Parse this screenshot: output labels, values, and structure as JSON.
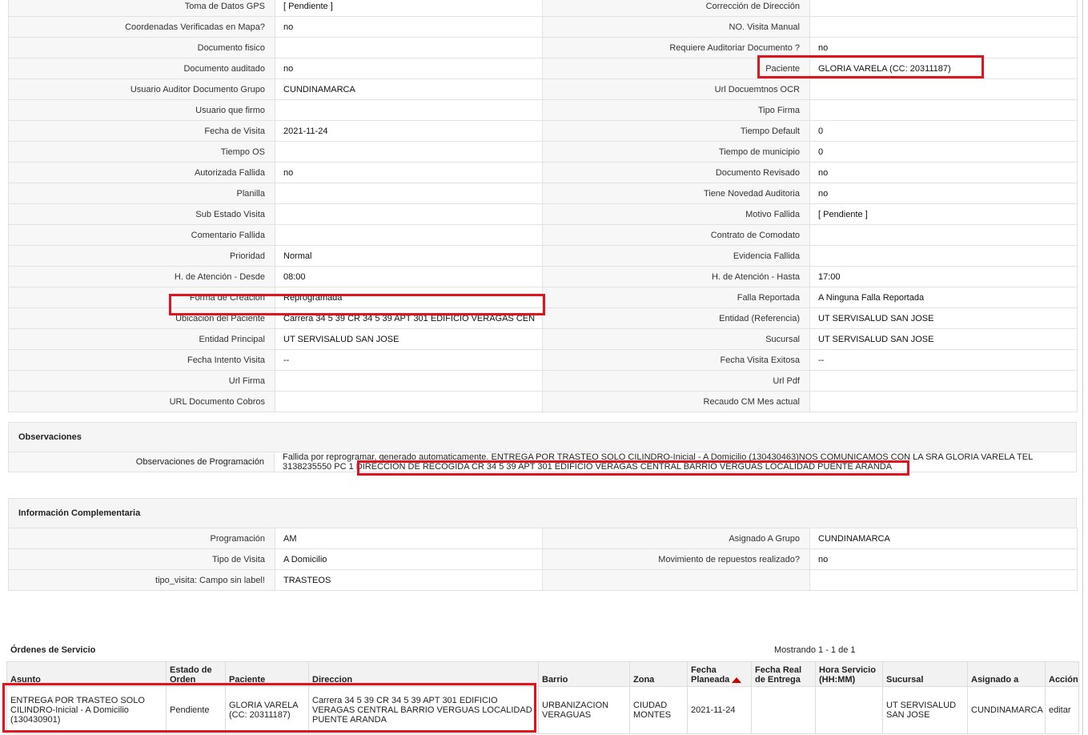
{
  "details": [
    {
      "l1": "Toma de Datos GPS",
      "v1": "[ Pendiente ]",
      "l2": "Corrección de Dirección",
      "v2": ""
    },
    {
      "l1": "Coordenadas Verificadas en Mapa?",
      "v1": "no",
      "l2": "NO. Visita Manual",
      "v2": ""
    },
    {
      "l1": "Documento fisico",
      "v1": "",
      "l2": "Requiere Auditoriar Documento ?",
      "v2": "no"
    },
    {
      "l1": "Documento auditado",
      "v1": "no",
      "l2": "Paciente",
      "v2": "GLORIA VARELA (CC: 20311187)"
    },
    {
      "l1": "Usuario Auditor Documento Grupo",
      "v1": "CUNDINAMARCA",
      "l2": "Url Docuemtnos OCR",
      "v2": ""
    },
    {
      "l1": "Usuario que firmo",
      "v1": "",
      "l2": "Tipo Firma",
      "v2": ""
    },
    {
      "l1": "Fecha de Visita",
      "v1": "2021-11-24",
      "l2": "Tiempo Default",
      "v2": "0"
    },
    {
      "l1": "Tiempo OS",
      "v1": "",
      "l2": "Tiempo de municipio",
      "v2": "0"
    },
    {
      "l1": "Autorizada Fallida",
      "v1": "no",
      "l2": "Documento Revisado",
      "v2": "no"
    },
    {
      "l1": "Planilla",
      "v1": "",
      "l2": "Tiene Novedad Auditoria",
      "v2": "no"
    },
    {
      "l1": "Sub Estado Visita",
      "v1": "",
      "l2": "Motivo Fallida",
      "v2": "[ Pendiente ]"
    },
    {
      "l1": "Comentario Fallida",
      "v1": "",
      "l2": "Contrato de Comodato",
      "v2": ""
    },
    {
      "l1": "Prioridad",
      "v1": "Normal",
      "l2": "Evidencia Fallida",
      "v2": ""
    },
    {
      "l1": "H. de Atención - Desde",
      "v1": "08:00",
      "l2": "H. de Atención - Hasta",
      "v2": "17:00"
    },
    {
      "l1": "Forma de Creación",
      "v1": "Reprogramada",
      "l2": "Falla Reportada",
      "v2": "A Ninguna Falla Reportada"
    },
    {
      "l1": "Ubicación del Paciente",
      "v1": "Carrera 34 5 39 CR 34 5 39 APT 301 EDIFICIO VERAGAS CEN",
      "l2": "Entidad (Referencia)",
      "v2": "UT SERVISALUD SAN JOSE"
    },
    {
      "l1": "Entidad Principal",
      "v1": "UT SERVISALUD SAN JOSE",
      "l2": "Sucursal",
      "v2": "UT SERVISALUD SAN JOSE"
    },
    {
      "l1": "Fecha Intento Visita",
      "v1": "--",
      "l2": "Fecha Visita Exitosa",
      "v2": "--"
    },
    {
      "l1": "Url Firma",
      "v1": "",
      "l2": "Url Pdf",
      "v2": ""
    },
    {
      "l1": "URL Documento Cobros",
      "v1": "",
      "l2": "Recaudo CM Mes actual",
      "v2": ""
    }
  ],
  "observaciones": {
    "title": "Observaciones",
    "label": "Observaciones de Programación",
    "text": "Fallida por reprogramar, generado automaticamente. ENTREGA POR TRASTEO SOLO CILINDRO-Inicial - A Domicilio (130430463)NOS COMUNICAMOS CON LA SRA GLORIA VARELA TEL 3138235550 PC 1 DIRECCION DE RECOGIDA CR 34 5 39 APT 301 EDIFICIO VERAGAS CENTRAL BARRIO VERGUAS LOCALIDAD PUENTE ARANDA"
  },
  "complementaria": {
    "title": "Información Complementaria",
    "rows": [
      {
        "l1": "Programación",
        "v1": "AM",
        "l2": "Asignado A Grupo",
        "v2": "CUNDINAMARCA"
      },
      {
        "l1": "Tipo de Visita",
        "v1": "A Domicilio",
        "l2": "Movimiento de repuestos realizado?",
        "v2": "no"
      },
      {
        "l1": "tipo_visita: Campo sin label!",
        "v1": "TRASTEOS",
        "l2": "",
        "v2": ""
      }
    ]
  },
  "ordenes": {
    "title": "Órdenes de Servicio",
    "count": "Mostrando 1 - 1 de 1",
    "headers": [
      "Asunto",
      "Estado de Orden",
      "Paciente",
      "Direccion",
      "Barrio",
      "Zona",
      "Fecha Planeada",
      "Fecha Real de Entrega",
      "Hora Servicio (HH:MM)",
      "Sucursal",
      "Asignado a",
      "Acción"
    ],
    "rows": [
      {
        "asunto": "ENTREGA POR TRASTEO SOLO CILINDRO-Inicial - A Domicilio (130430901)",
        "estado": "Pendiente",
        "paciente": "GLORIA VARELA (CC: 20311187)",
        "direccion": "Carrera 34 5 39 CR 34 5 39 APT 301 EDIFICIO VERAGAS CENTRAL BARRIO VERGUAS LOCALIDAD PUENTE ARANDA",
        "barrio": "URBANIZACION VERAGUAS",
        "zona": "CIUDAD MONTES",
        "fecha_planeada": "2021-11-24",
        "fecha_real": "",
        "hora": "",
        "sucursal": "UT SERVISALUD SAN JOSE",
        "asignado": "CUNDINAMARCA",
        "accion": "editar"
      }
    ]
  },
  "colors": {
    "highlight": "#e0141e",
    "label_bg": "#f7f7f7",
    "border": "#e2e2e2"
  }
}
